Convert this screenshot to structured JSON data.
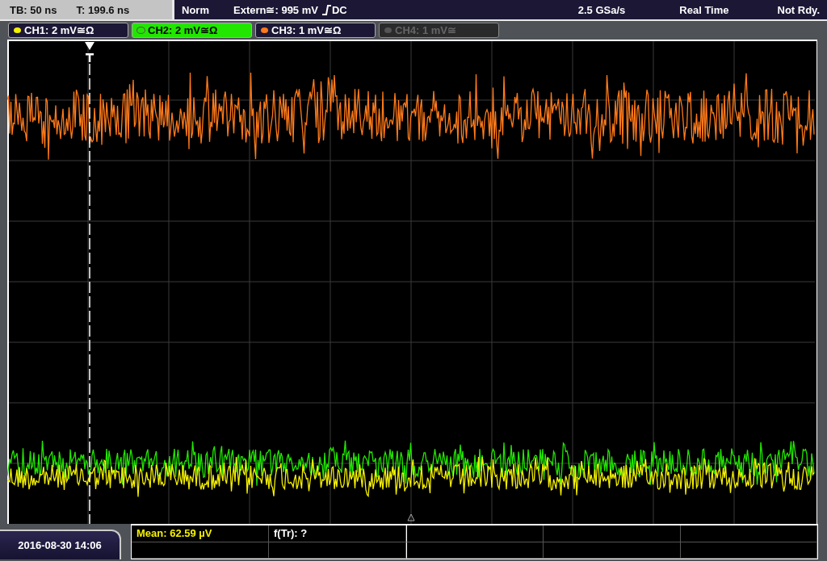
{
  "status_bar": {
    "timebase": "TB: 50 ns",
    "trigger_time": "T: 199.6 ns",
    "mode": "Norm",
    "trigger_source": "Extern≅: 995 mV",
    "coupling": "DC",
    "sample_rate": "2.5 GSa/s",
    "acquisition": "Real Time",
    "state": "Not Rdy."
  },
  "channels": [
    {
      "label": "CH1: 2 mV≅Ω",
      "color": "#f5f000",
      "selected": false,
      "disabled": false
    },
    {
      "label": "CH2: 2 mV≅Ω",
      "color": "#22e600",
      "selected": true,
      "disabled": false
    },
    {
      "label": "CH3: 1 mV≅Ω",
      "color": "#ff7a1a",
      "selected": false,
      "disabled": false
    },
    {
      "label": "CH4: 1 mV≅",
      "color": "#555555",
      "selected": false,
      "disabled": true
    }
  ],
  "datetime": "2016-08-30 14:06",
  "measurements": [
    {
      "text": "Mean: 62.59 µV",
      "color": "#f5f000"
    },
    {
      "text": "f(Tr): ?",
      "color": "#ffffff"
    }
  ]
}
